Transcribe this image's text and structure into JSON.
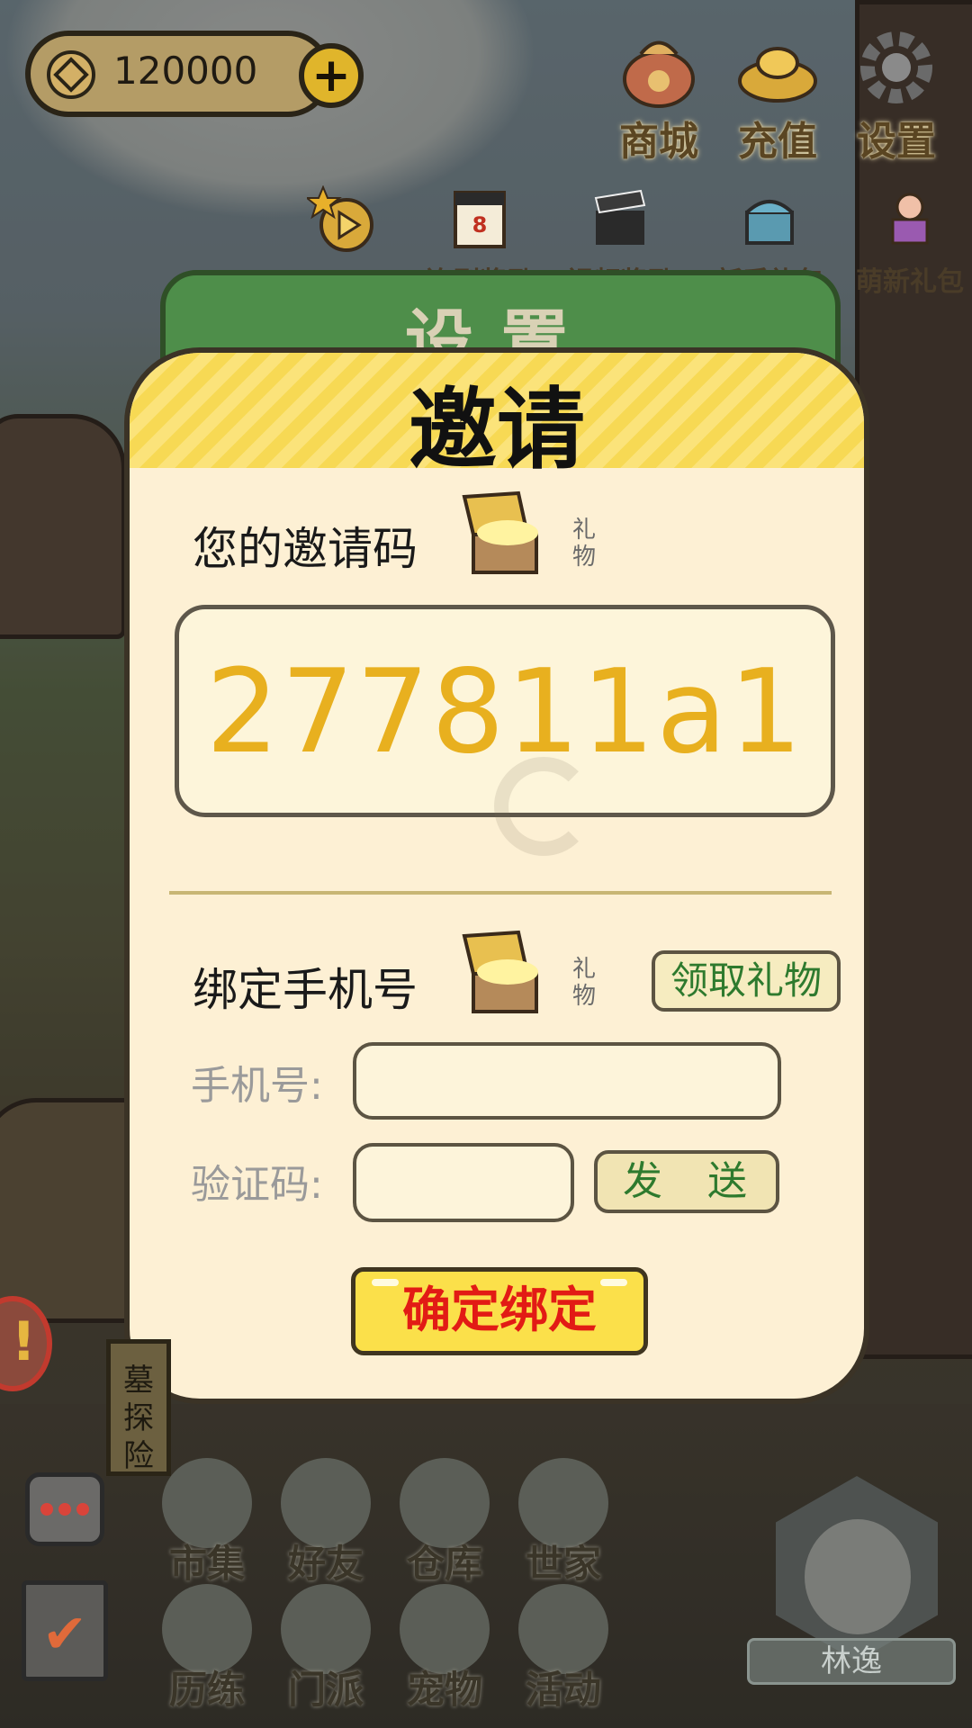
{
  "hud": {
    "coins": "120000",
    "add_coins_label": "+",
    "top_buttons": [
      {
        "label": "商城",
        "icon": "lucky-bag-icon"
      },
      {
        "label": "充值",
        "icon": "gold-ingot-icon"
      },
      {
        "label": "设置",
        "icon": "gear-icon"
      }
    ],
    "reward_row": [
      {
        "label": "",
        "icon": "star-play-icon"
      },
      {
        "label": "连刷奖励",
        "icon": "calendar-icon"
      },
      {
        "label": "视频奖励",
        "icon": "clapper-icon"
      },
      {
        "label": "新手礼包",
        "icon": "treasure-chest-icon"
      },
      {
        "label": "萌新礼包",
        "icon": "pig-mascot-icon"
      }
    ]
  },
  "settings_panel": {
    "title": "设置"
  },
  "invite_dialog": {
    "title": "邀请",
    "code_label": "您的邀请码",
    "gift_note": "礼物",
    "invite_code": "277811a1",
    "bind_label": "绑定手机号",
    "claim_button": "领取礼物",
    "phone_label": "手机号:",
    "phone_value": "",
    "code_field_label": "验证码:",
    "code_value": "",
    "send_button": "发 送",
    "confirm_button": "确定绑定"
  },
  "side": {
    "tomb_label": "墓探险",
    "alert_icon": "exclamation-icon"
  },
  "bottom_menu": [
    {
      "label": "市集",
      "icon": "market-icon"
    },
    {
      "label": "好友",
      "icon": "handshake-icon"
    },
    {
      "label": "仓库",
      "icon": "chest-icon"
    },
    {
      "label": "世家",
      "icon": "teapot-icon"
    },
    {
      "label": "历练",
      "icon": "crossed-swords-icon"
    },
    {
      "label": "门派",
      "icon": "banner-icon"
    },
    {
      "label": "宠物",
      "icon": "paw-icon"
    },
    {
      "label": "活动",
      "icon": "lantern-icon"
    }
  ],
  "player": {
    "name": "林逸"
  }
}
